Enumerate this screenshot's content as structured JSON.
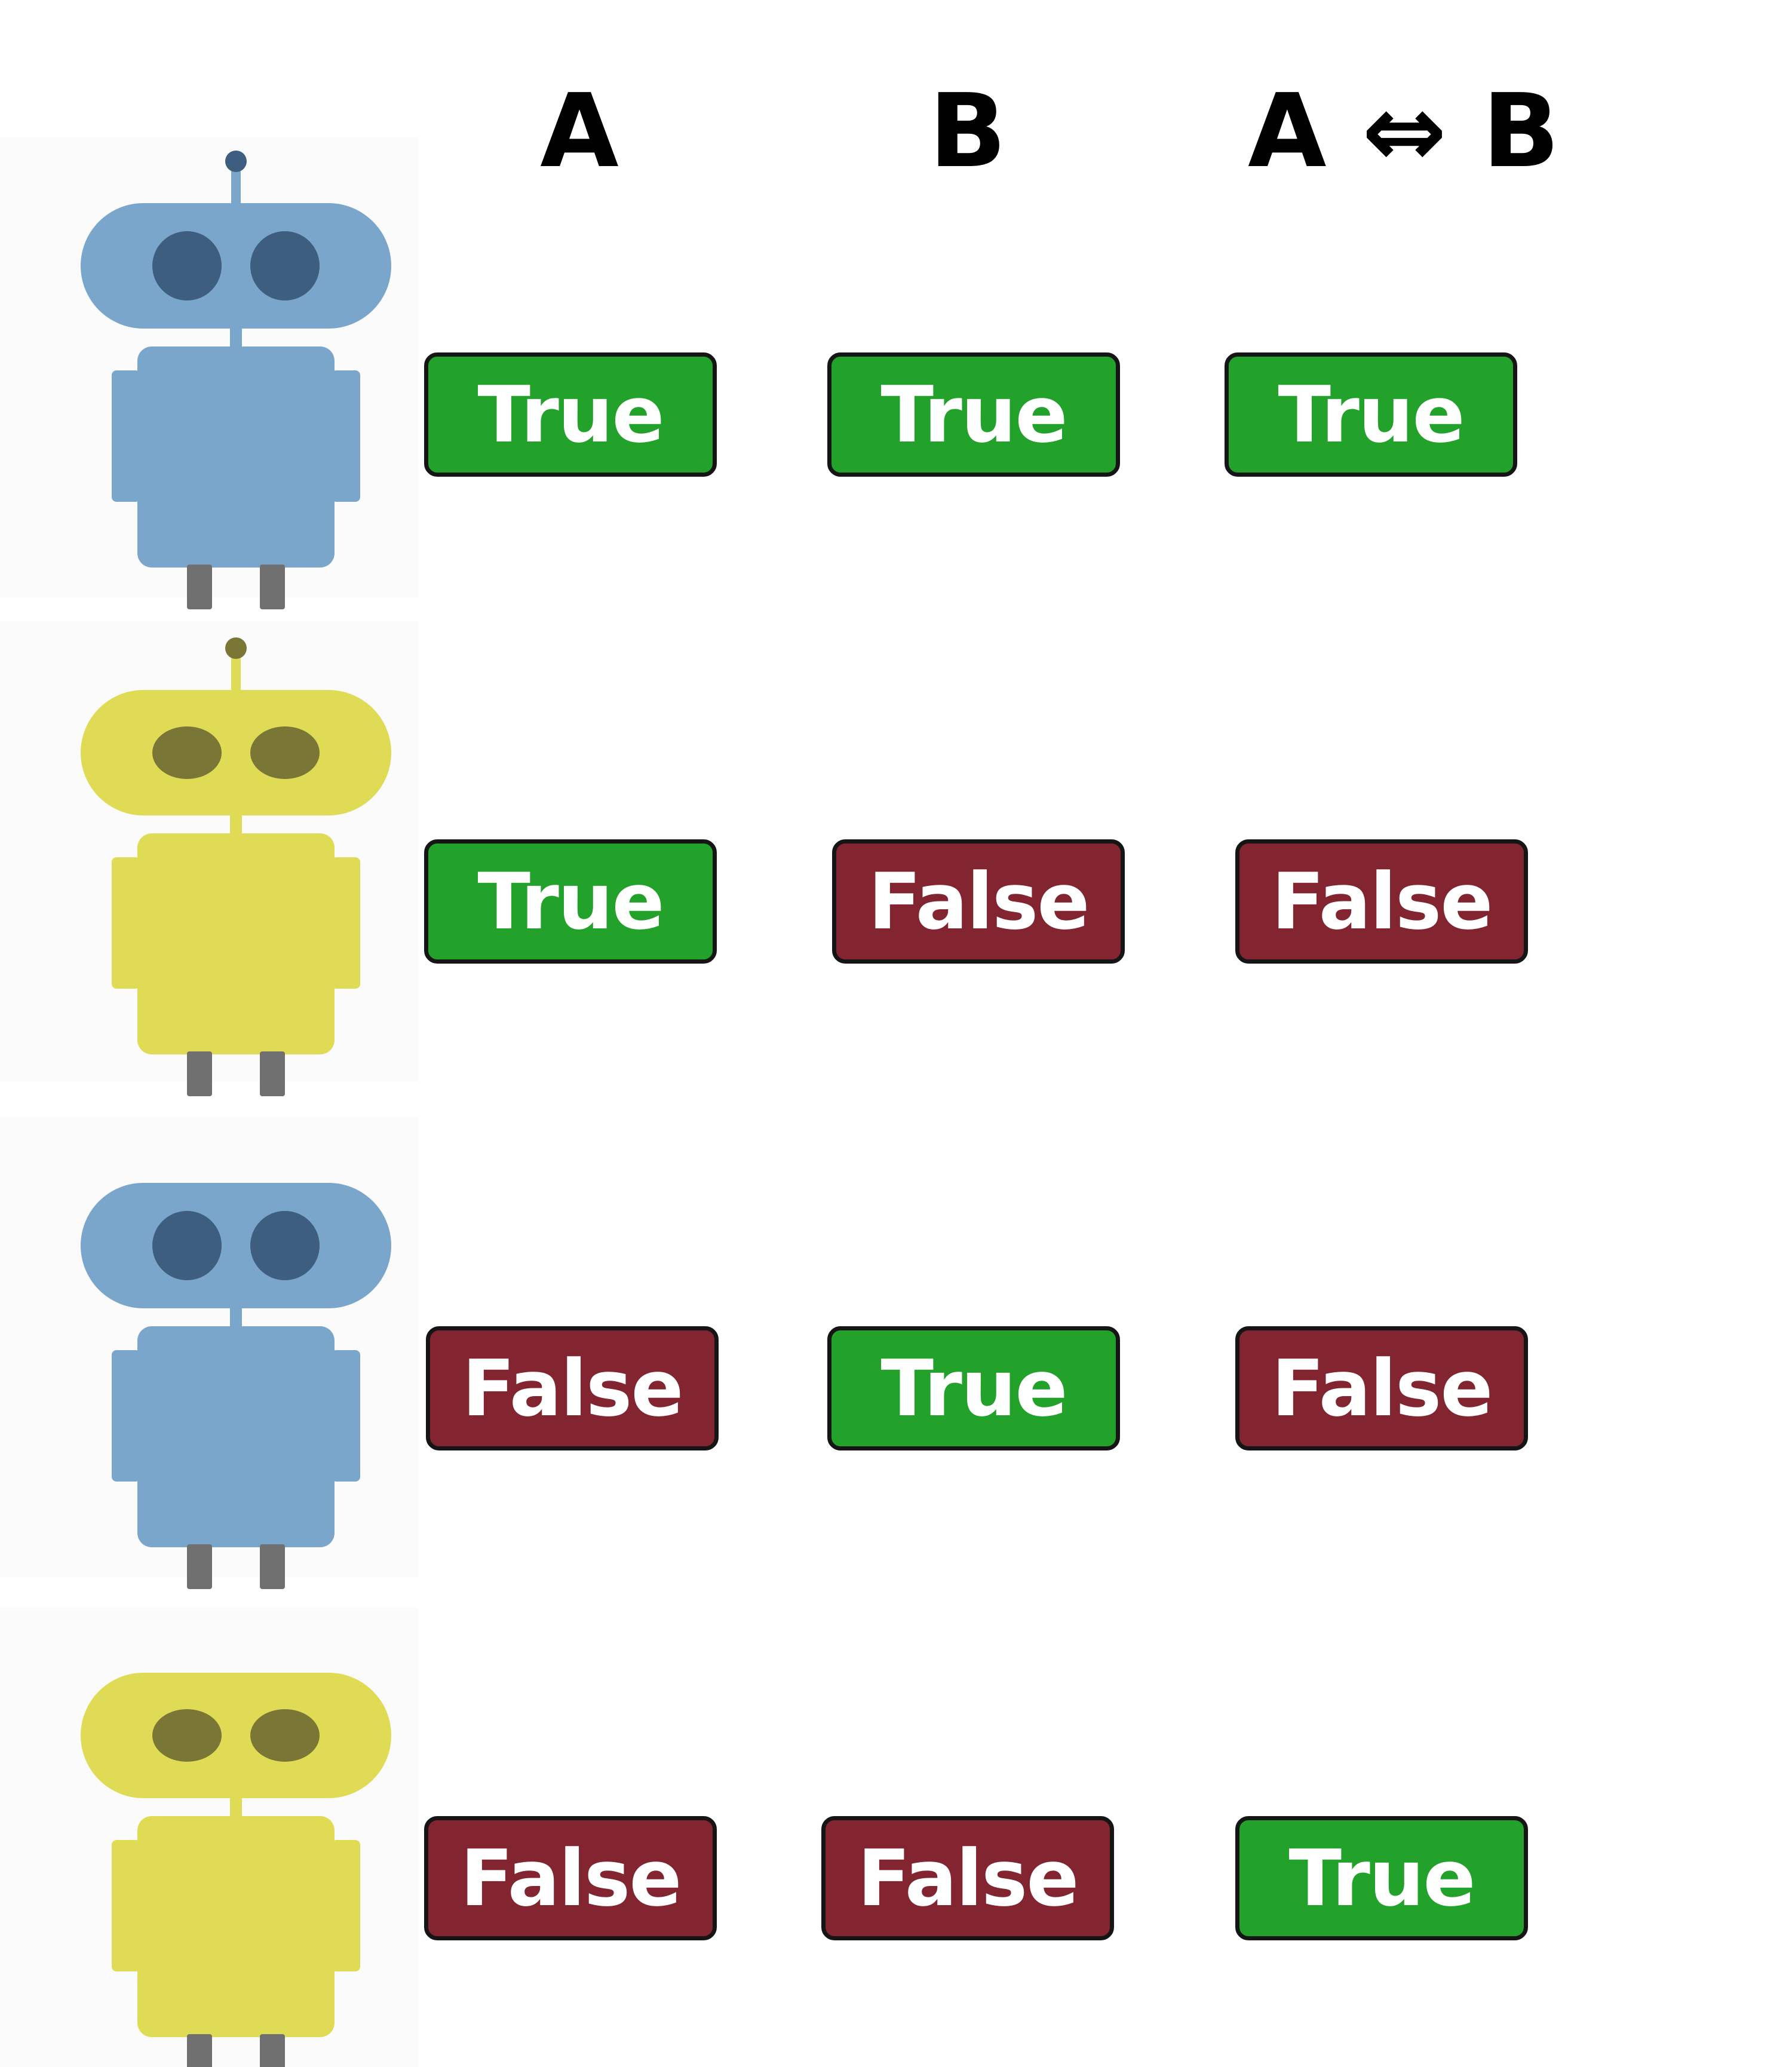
{
  "headers": {
    "a": "A",
    "b": "B",
    "a_iff_b": "A ⇔ B"
  },
  "colors": {
    "true_badge": "#22a22b",
    "false_badge": "#832530",
    "badge_border": "#151515",
    "blue_robot_body": "#7aa6cb",
    "blue_robot_eye": "#3d5e7e",
    "yellow_robot_body": "#e0db55",
    "yellow_robot_eye": "#7a7636",
    "robot_leg": "#707070"
  },
  "rows": [
    {
      "robot": {
        "color": "blue",
        "antenna": true
      },
      "a": "True",
      "b": "True",
      "a_iff_b": "True"
    },
    {
      "robot": {
        "color": "yellow",
        "antenna": true
      },
      "a": "True",
      "b": "False",
      "a_iff_b": "False"
    },
    {
      "robot": {
        "color": "blue",
        "antenna": false
      },
      "a": "False",
      "b": "True",
      "a_iff_b": "False"
    },
    {
      "robot": {
        "color": "yellow",
        "antenna": false
      },
      "a": "False",
      "b": "False",
      "a_iff_b": "True"
    }
  ]
}
